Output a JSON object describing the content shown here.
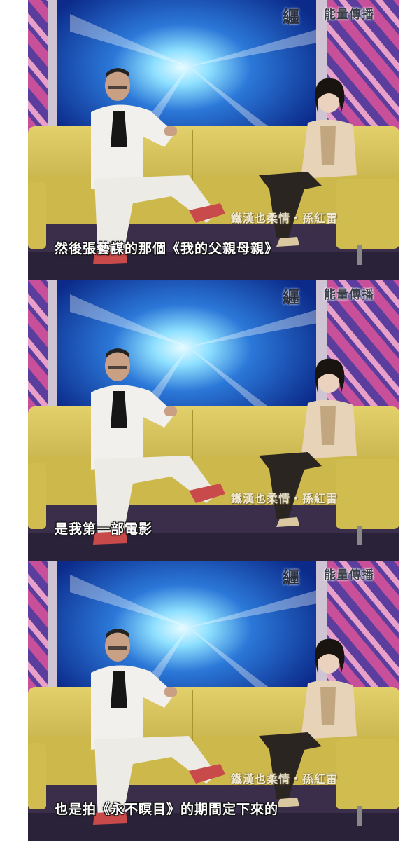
{
  "frames": [
    {
      "logo_glyph": "纒",
      "logo_text": "能量傳播",
      "lower_third": "鐵漢也柔情・孫紅雷",
      "subtitle": "然後張藝謀的那個《我的父親母親》"
    },
    {
      "logo_glyph": "纒",
      "logo_text": "能量傳播",
      "lower_third": "鐵漢也柔情・孫紅雷",
      "subtitle": "是我第一部電影"
    },
    {
      "logo_glyph": "纒",
      "logo_text": "能量傳播",
      "lower_third": "鐵漢也柔情・孫紅雷",
      "subtitle": "也是拍《永不瞑目》的期間定下來的"
    }
  ],
  "colors": {
    "sofa": "#d7c457",
    "backdrop_blue": "#1f5fc8",
    "backdrop_light": "#8fe0ff",
    "stripes_pink": "#c8509a",
    "stripes_purple": "#5a3d9c",
    "suit": "#f2f0ec",
    "floor": "#3a2e4a"
  }
}
